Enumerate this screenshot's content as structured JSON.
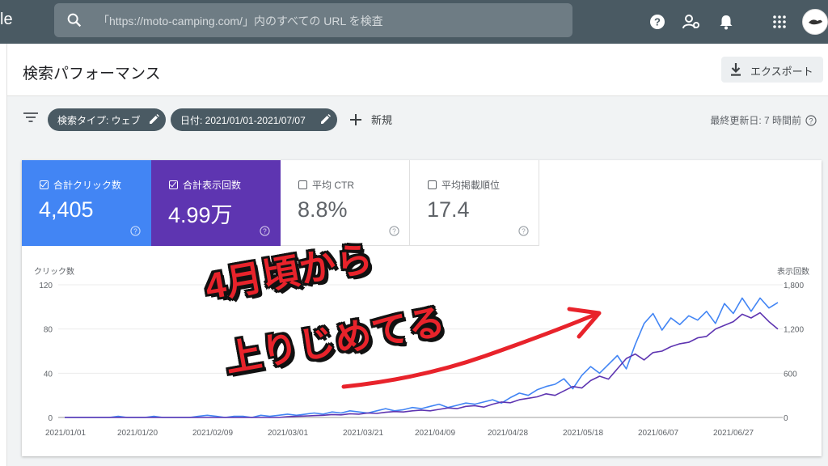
{
  "app": {
    "brand_fragment": "le"
  },
  "search": {
    "placeholder": "「https://moto-camping.com/」内のすべての URL を検査"
  },
  "topbar_icons": [
    "help-icon",
    "user-settings-icon",
    "bell-icon",
    "apps-grid-icon",
    "avatar"
  ],
  "header": {
    "title": "検索パフォーマンス",
    "export_label": "エクスポート"
  },
  "filters": {
    "chips": [
      {
        "label": "検索タイプ: ウェブ"
      },
      {
        "label": "日付: 2021/01/01-2021/07/07"
      }
    ],
    "new_label": "新規",
    "last_updated": "最終更新日: 7 時間前"
  },
  "metrics": [
    {
      "label": "合計クリック数",
      "value": "4,405",
      "checked": true,
      "color": "#4285f4"
    },
    {
      "label": "合計表示回数",
      "value": "4.99万",
      "checked": true,
      "color": "#5e35b1"
    },
    {
      "label": "平均 CTR",
      "value": "8.8%",
      "checked": false
    },
    {
      "label": "平均掲載順位",
      "value": "17.4",
      "checked": false
    }
  ],
  "chart_data": {
    "type": "line",
    "left_axis_label": "クリック数",
    "right_axis_label": "表示回数",
    "left_ticks": [
      "120",
      "80",
      "40",
      "0"
    ],
    "right_ticks": [
      "1,800",
      "1,200",
      "600",
      "0"
    ],
    "left_range": [
      0,
      120
    ],
    "right_range": [
      0,
      1800
    ],
    "x_ticks": [
      "2021/01/01",
      "2021/01/20",
      "2021/02/09",
      "2021/03/01",
      "2021/03/21",
      "2021/04/09",
      "2021/04/28",
      "2021/05/18",
      "2021/06/07",
      "2021/06/27"
    ],
    "series": [
      {
        "name": "合計クリック数",
        "color": "#4285f4",
        "axis": "left",
        "values": [
          0,
          0,
          0,
          0,
          0,
          0,
          1,
          0,
          0,
          0,
          1,
          0,
          0,
          0,
          0,
          1,
          2,
          1,
          0,
          1,
          1,
          0,
          2,
          1,
          2,
          3,
          2,
          3,
          4,
          3,
          5,
          4,
          6,
          5,
          4,
          6,
          8,
          6,
          7,
          9,
          8,
          10,
          12,
          9,
          11,
          13,
          12,
          14,
          16,
          13,
          18,
          22,
          20,
          25,
          28,
          30,
          35,
          26,
          38,
          46,
          40,
          48,
          56,
          44,
          66,
          85,
          94,
          79,
          90,
          84,
          92,
          88,
          96,
          85,
          103,
          94,
          108,
          96,
          108,
          99,
          104
        ]
      },
      {
        "name": "合計表示回数",
        "color": "#5e35b1",
        "axis": "right",
        "values": [
          0,
          0,
          0,
          0,
          0,
          0,
          0,
          0,
          0,
          0,
          0,
          0,
          0,
          0,
          0,
          0,
          0,
          0,
          0,
          0,
          0,
          0,
          0,
          0,
          0,
          10,
          15,
          20,
          25,
          30,
          40,
          35,
          50,
          45,
          60,
          55,
          70,
          80,
          75,
          90,
          100,
          90,
          110,
          130,
          120,
          150,
          160,
          140,
          180,
          210,
          200,
          240,
          260,
          280,
          320,
          300,
          360,
          420,
          400,
          500,
          560,
          520,
          660,
          800,
          860,
          780,
          880,
          900,
          960,
          1000,
          1020,
          1080,
          1100,
          1200,
          1250,
          1300,
          1400,
          1350,
          1420,
          1300,
          1200
        ]
      }
    ]
  },
  "annotation": {
    "line1": "4月頃から",
    "line2": "上りじめてる"
  }
}
